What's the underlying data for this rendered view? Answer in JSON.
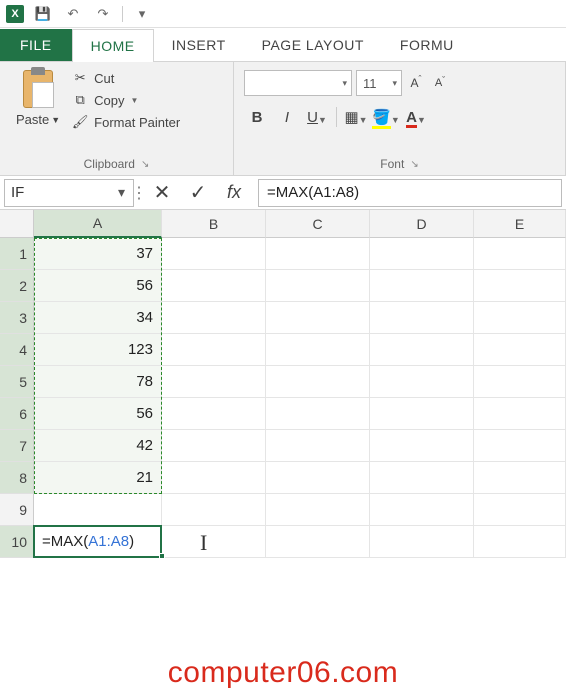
{
  "qat": {
    "logo": "X"
  },
  "tabs": {
    "file": "FILE",
    "home": "HOME",
    "insert": "INSERT",
    "page_layout": "PAGE LAYOUT",
    "formulas": "FORMU"
  },
  "clipboard": {
    "paste": "Paste",
    "cut": "Cut",
    "copy": "Copy",
    "format_painter": "Format Painter",
    "group_label": "Clipboard"
  },
  "font": {
    "family": "",
    "size": "11",
    "group_label": "Font",
    "bold": "B",
    "italic": "I",
    "underline": "U",
    "increase": "A",
    "decrease": "A"
  },
  "formula_bar": {
    "name_box": "IF",
    "formula": "=MAX(A1:A8)"
  },
  "columns": [
    "A",
    "B",
    "C",
    "D",
    "E"
  ],
  "rows": [
    {
      "n": "1",
      "A": "37"
    },
    {
      "n": "2",
      "A": "56"
    },
    {
      "n": "3",
      "A": "34"
    },
    {
      "n": "4",
      "A": "123"
    },
    {
      "n": "5",
      "A": "78"
    },
    {
      "n": "6",
      "A": "56"
    },
    {
      "n": "7",
      "A": "42"
    },
    {
      "n": "8",
      "A": "21"
    },
    {
      "n": "9",
      "A": ""
    },
    {
      "n": "10",
      "A": "=MAX(",
      "range": "A1:A8",
      "tail": ")"
    }
  ],
  "watermark": "computer06.com"
}
